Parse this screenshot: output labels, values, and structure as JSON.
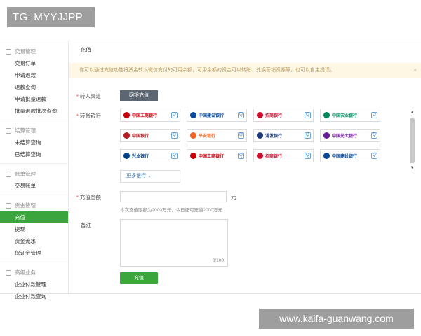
{
  "watermarks": {
    "top": "TG: MYYJJPP",
    "bottom": "www.kaifa-guanwang.com"
  },
  "sidebar": {
    "groups": [
      {
        "title": "交易管理",
        "icon": "list-icon",
        "items": [
          "交易订单",
          "申请退款",
          "退款查询",
          "申请批量退款",
          "批量退款批次查询"
        ]
      },
      {
        "title": "结算管理",
        "icon": "grid-icon",
        "items": [
          "未结算查询",
          "已结算查询"
        ]
      },
      {
        "title": "账单管理",
        "icon": "document-icon",
        "items": [
          "交易账单"
        ]
      },
      {
        "title": "资金管理",
        "icon": "wallet-icon",
        "items": [
          "充值",
          "提现",
          "资金流水",
          "保证金管理"
        ]
      },
      {
        "title": "高级业务",
        "icon": "cloud-icon",
        "items": [
          "企业付款管理",
          "企业付款查询"
        ]
      }
    ],
    "active_item": "充值"
  },
  "main": {
    "title": "充值",
    "notice": "你可以通过充值功能将资金转入微信支付的可用余额，可用余额的资金可以转账、兑换营销资源等，也可以自主提现。",
    "notice_close": "×",
    "channel_label": "转入渠道",
    "channel_button": "网银充值",
    "bank_label": "转账银行",
    "banks": [
      {
        "name": "中国工商银行",
        "color": "#c7000b"
      },
      {
        "name": "中国建设银行",
        "color": "#0a4b9c"
      },
      {
        "name": "招商银行",
        "color": "#c8102e"
      },
      {
        "name": "中国农业银行",
        "color": "#00875a"
      },
      {
        "name": "中国银行",
        "color": "#b81c22"
      },
      {
        "name": "平安银行",
        "color": "#f26522"
      },
      {
        "name": "浦发银行",
        "color": "#1f3a7a"
      },
      {
        "name": "中国光大银行",
        "color": "#6a1b9a"
      },
      {
        "name": "兴业银行",
        "color": "#00418c"
      },
      {
        "name": "中国工商银行",
        "color": "#c7000b"
      },
      {
        "name": "招商银行",
        "color": "#c8102e"
      },
      {
        "name": "中国建设银行",
        "color": "#0a4b9c"
      }
    ],
    "bank_quick_icon": "Q",
    "more_banks": "更多银行",
    "amount_label": "充值金额",
    "amount_unit": "元",
    "amount_hint": "本次充值限额为2000万元，今日还可充值2000万元",
    "remark_label": "备注",
    "remark_counter": "0/100",
    "submit": "充值"
  },
  "colors": {
    "accent": "#3aa53c",
    "notice_bg": "#fdf7e3",
    "channel_btn": "#5c6673"
  }
}
